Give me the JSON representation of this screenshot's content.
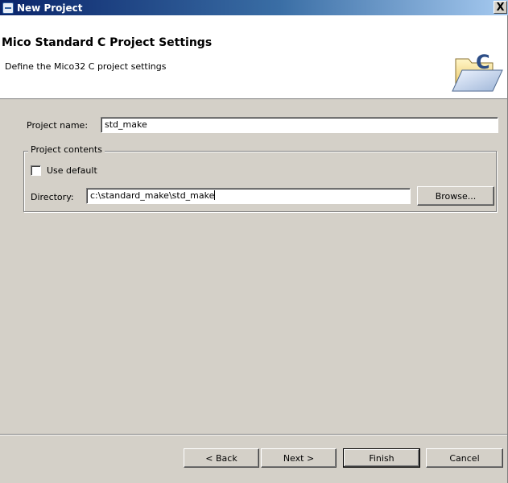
{
  "window": {
    "title": "New Project",
    "close_label": "X"
  },
  "header": {
    "heading": "Mico Standard C Project Settings",
    "subheading": "Define the Mico32 C project settings",
    "graphic_icon": "folder-c-icon",
    "graphic_letter": "C"
  },
  "form": {
    "project_name_label": "Project name:",
    "project_name_value": "std_make",
    "contents_group_label": "Project contents",
    "use_default_label": "Use default",
    "use_default_checked": false,
    "directory_label": "Directory:",
    "directory_value": "c:\\standard_make\\std_make",
    "browse_label": "Browse..."
  },
  "footer": {
    "back_label": "< Back",
    "next_label": "Next >",
    "finish_label": "Finish",
    "cancel_label": "Cancel"
  },
  "colors": {
    "titlebar_start": "#0a246a",
    "titlebar_end": "#a6caf0",
    "dialog_bg": "#d4d0c8",
    "header_bg": "#ffffff"
  }
}
